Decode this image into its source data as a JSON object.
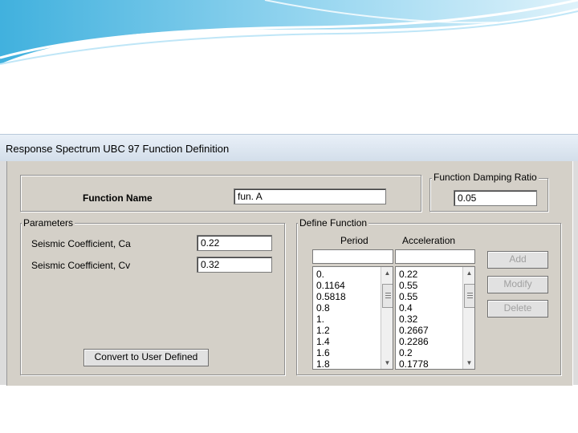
{
  "window": {
    "title": "Response Spectrum UBC 97 Function Definition"
  },
  "function_name": {
    "label": "Function Name",
    "value": "fun. A"
  },
  "damping": {
    "legend": "Function Damping Ratio",
    "value": "0.05"
  },
  "parameters": {
    "legend": "Parameters",
    "ca_label": "Seismic Coefficient, Ca",
    "ca_value": "0.22",
    "cv_label": "Seismic Coefficient, Cv",
    "cv_value": "0.32",
    "convert_button": "Convert to User Defined"
  },
  "define_function": {
    "legend": "Define Function",
    "period_header": "Period",
    "acceleration_header": "Acceleration",
    "periods": [
      "0.",
      "0.1164",
      "0.5818",
      "0.8",
      "1.",
      "1.2",
      "1.4",
      "1.6",
      "1.8"
    ],
    "accelerations": [
      "0.22",
      "0.55",
      "0.55",
      "0.4",
      "0.32",
      "0.2667",
      "0.2286",
      "0.2",
      "0.1778"
    ],
    "add_button": "Add",
    "modify_button": "Modify",
    "delete_button": "Delete"
  },
  "colors": {
    "swoosh_blue": "#4fb3e6",
    "window_bg": "#d4d0c8"
  }
}
